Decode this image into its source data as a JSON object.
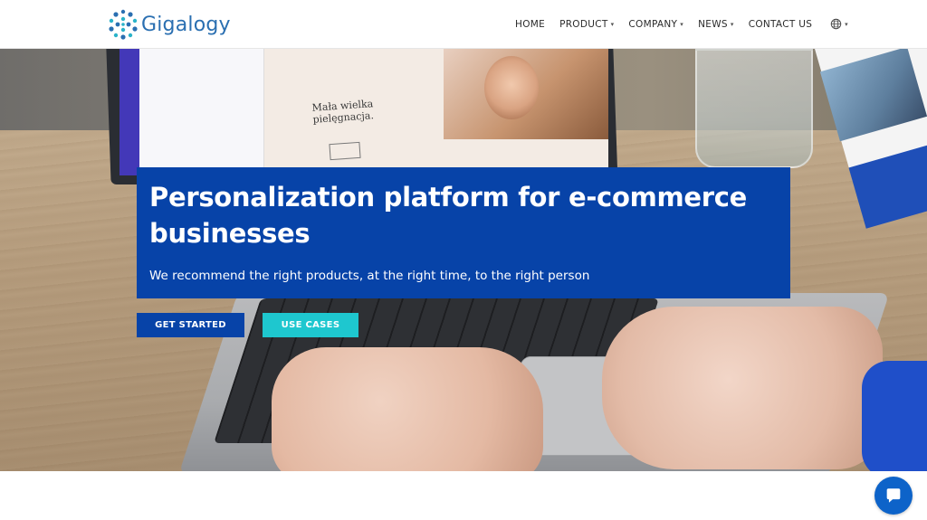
{
  "header": {
    "logo_text": "Gigalogy",
    "nav": [
      {
        "label": "HOME",
        "dropdown": false
      },
      {
        "label": "PRODUCT",
        "dropdown": true
      },
      {
        "label": "COMPANY",
        "dropdown": true
      },
      {
        "label": "NEWS",
        "dropdown": true
      },
      {
        "label": "CONTACT US",
        "dropdown": false
      }
    ],
    "language_icon": "globe-icon"
  },
  "hero": {
    "title": "Personalization platform for e-commerce businesses",
    "subtitle": "We recommend the right products, at the right time, to the right person",
    "buttons": {
      "get_started": "GET STARTED",
      "use_cases": "USE CASES"
    },
    "screen_heading": "Mała wielka pielęgnacja."
  },
  "chat_widget": {
    "icon": "chat-bubble-icon"
  },
  "colors": {
    "brand_blue": "#0743a8",
    "accent_teal": "#1ec7cf",
    "chat_blue": "#0d63c9"
  }
}
